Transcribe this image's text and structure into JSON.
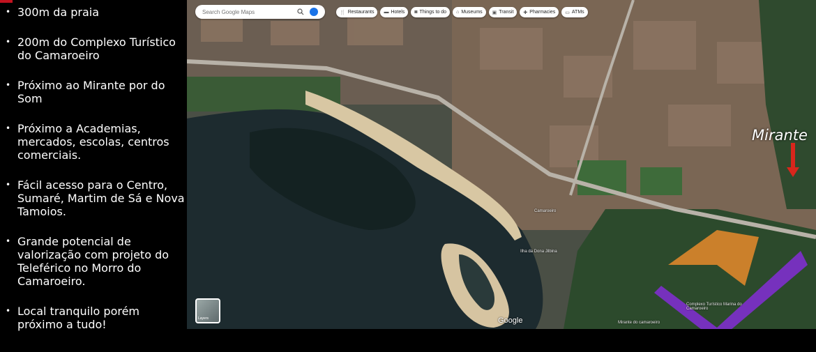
{
  "bullets": [
    "300m da praia",
    "200m do Complexo Turístico do Camaroeiro",
    "Próximo ao Mirante por do Som",
    "Próximo a Academias, mercados, escolas, centros comerciais.",
    "Fácil acesso para o Centro, Sumaré, Martim de Sá e Nova Tamoios.",
    "Grande potencial de valorização com projeto do Teleférico no Morro do Camaroeiro.",
    "Local tranquilo porém próximo a tudo!"
  ],
  "map": {
    "search_placeholder": "Search Google Maps",
    "chips": [
      {
        "icon": "restaurant-icon",
        "label": "Restaurants"
      },
      {
        "icon": "hotel-icon",
        "label": "Hotels"
      },
      {
        "icon": "camera-icon",
        "label": "Things to do"
      },
      {
        "icon": "museum-icon",
        "label": "Museums"
      },
      {
        "icon": "transit-icon",
        "label": "Transit"
      },
      {
        "icon": "pharmacy-icon",
        "label": "Pharmacies"
      },
      {
        "icon": "atm-icon",
        "label": "ATMs"
      }
    ],
    "annotation": "Mirante",
    "layers_label": "Layers",
    "watermark": "Google",
    "labels": {
      "camaroeiro": "Camaroeiro",
      "ilha": "Ilha da Dona Jilbina",
      "complexo": "Complexo Turístico Marina do Camaroeiro",
      "mirante_label": "Mirante do camaroeiro"
    },
    "colors": {
      "arrow": "#d9261c",
      "logo_orange": "#e8892b",
      "logo_purple": "#8a2be2"
    }
  }
}
